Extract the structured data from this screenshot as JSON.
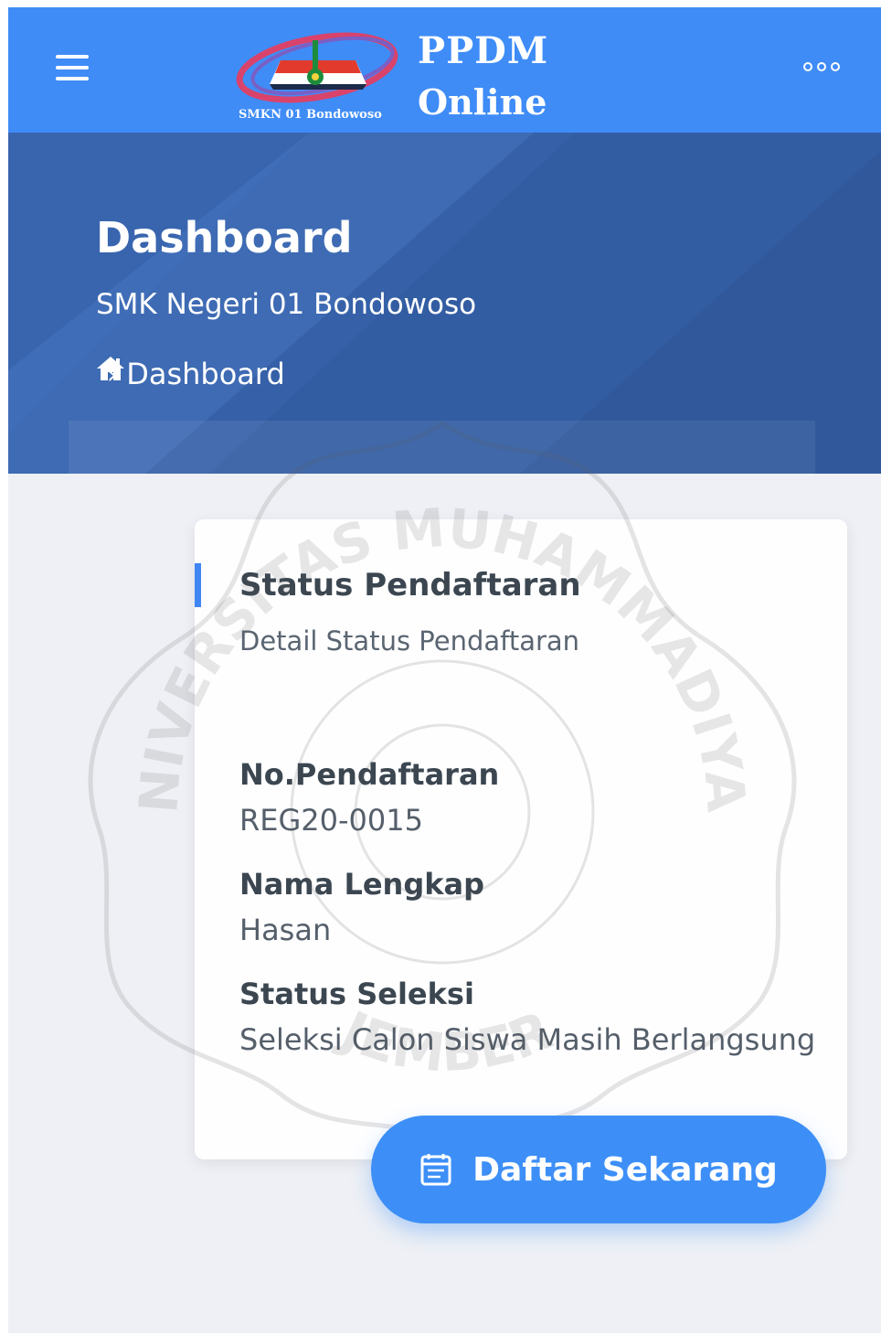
{
  "appbar": {
    "logo_caption": "SMKN 01 Bondowoso",
    "brand_line1": "PPDM",
    "brand_line2": "Online",
    "menu_icon": "hamburger-icon",
    "more_icon": "more-horizontal-icon",
    "background": "#3f8cf7"
  },
  "hero": {
    "title": "Dashboard",
    "subtitle": "SMK Negeri 01 Bondowoso",
    "breadcrumb_icon": "home-icon",
    "breadcrumb_separator": "›",
    "breadcrumb_current": "Dashboard",
    "background": "#3661a8"
  },
  "card": {
    "title": "Status Pendaftaran",
    "subtitle": "Detail Status Pendaftaran",
    "fields": [
      {
        "label": "No.Pendaftaran",
        "value": "REG20-0015"
      },
      {
        "label": "Nama Lengkap",
        "value": "Hasan"
      },
      {
        "label": "Status Seleksi",
        "value": "Seleksi Calon Siswa Masih Berlangsung"
      }
    ]
  },
  "action": {
    "label": "Daftar Sekarang",
    "icon": "register-form-icon",
    "color": "#3d8ff7"
  },
  "watermark": {
    "text_top": "UNIVERSITAS MUHAMMADIYAH",
    "text_bottom": "JEMBER"
  }
}
